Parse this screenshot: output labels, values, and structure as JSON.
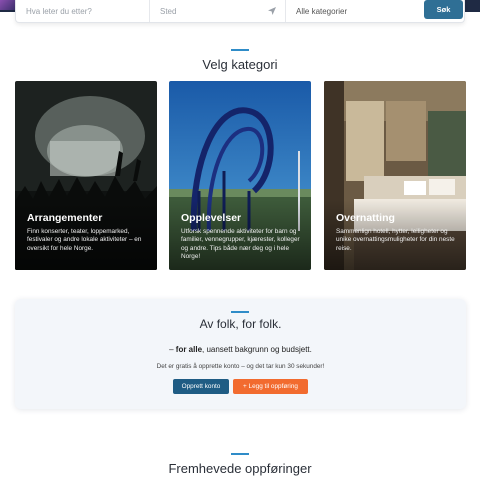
{
  "search": {
    "what_placeholder": "Hva leter du etter?",
    "where_placeholder": "Sted",
    "category_selected": "Alle kategorier",
    "button_label": "Søk"
  },
  "categories_section": {
    "title": "Velg kategori",
    "cards": [
      {
        "title": "Arrangementer",
        "description": "Finn konserter, teater, loppemarked, festivaler og andre lokale aktiviteter – en oversikt for hele Norge."
      },
      {
        "title": "Opplevelser",
        "description": "Utforsk spennende aktiviteter for barn og familier, vennegrupper, kjærester, kolleger og andre. Tips både nær deg og i hele Norge!"
      },
      {
        "title": "Overnatting",
        "description": "Sammenlign hotell, hytter, leiligheter og unike overnattingsmuligheter for din neste reise."
      }
    ]
  },
  "cta": {
    "title": "Av folk, for folk.",
    "line_prefix": "– ",
    "line_bold": "for alle",
    "line_rest": ", uansett bakgrunn og budsjett.",
    "small": "Det er gratis å opprette konto – og det tar kun 30 sekunder!",
    "primary_button": "Opprett konto",
    "secondary_button": "+ Legg til oppføring"
  },
  "featured_section": {
    "title": "Fremhevede oppføringer"
  },
  "colors": {
    "accent_blue": "#2f8cc8",
    "search_button": "#2f6f95",
    "primary_button": "#1f5c84",
    "orange_button": "#f26b2f",
    "cta_background": "#f3f6fa"
  },
  "icons": {
    "location": "location-arrow-icon"
  }
}
